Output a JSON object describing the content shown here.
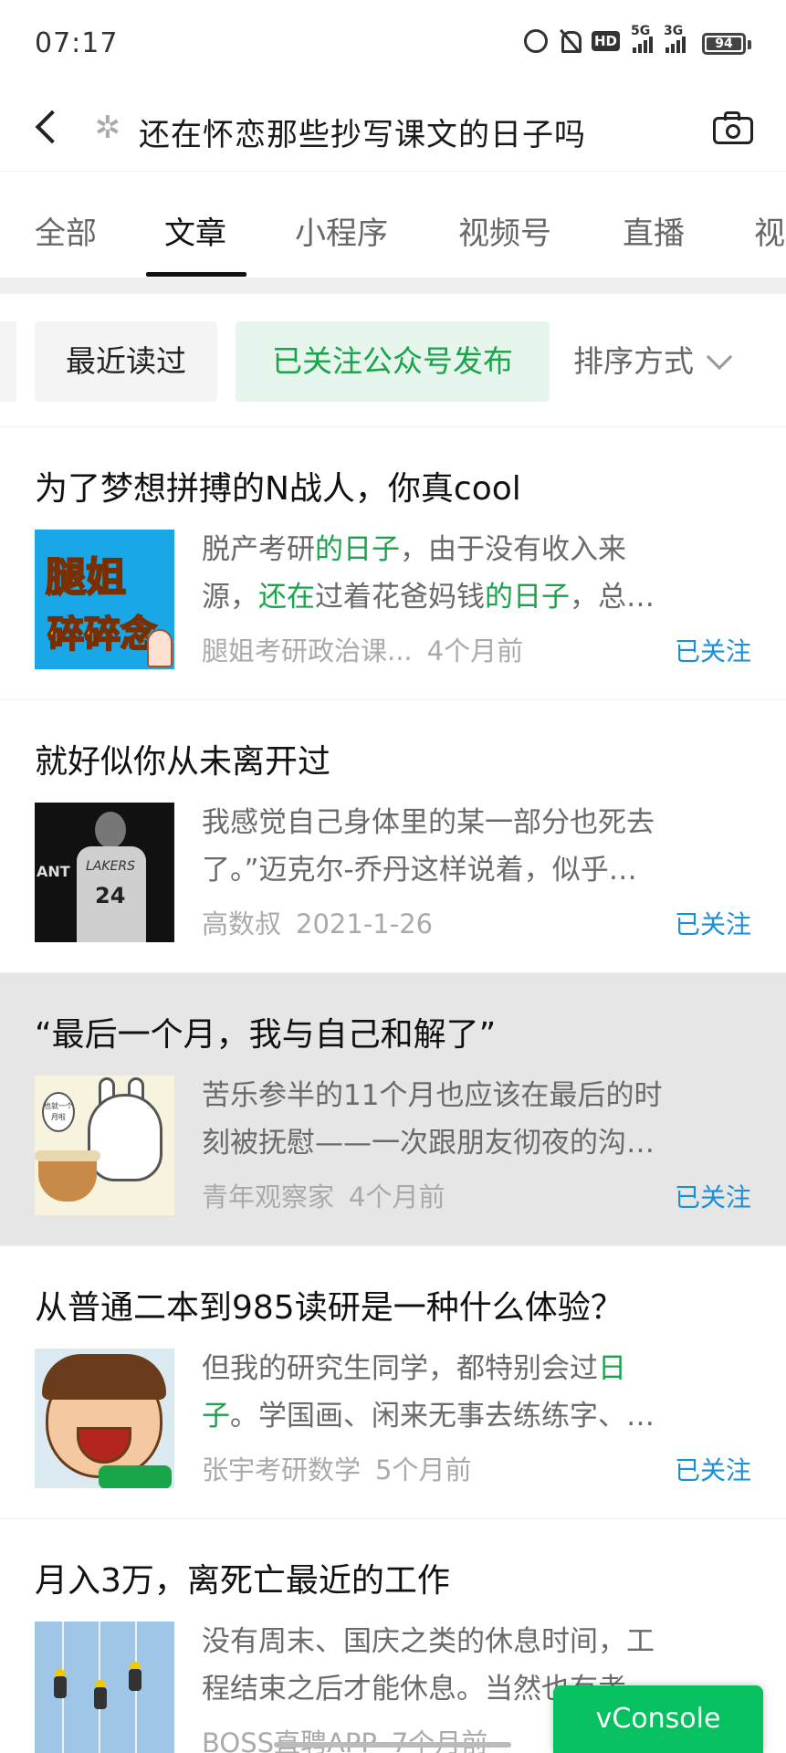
{
  "status_bar": {
    "time": "07:17",
    "hd_label": "HD",
    "net1_label": "5G",
    "net2_label": "3G",
    "battery_level": "94",
    "battery_fraction": 0.94,
    "icons": [
      "alarm-icon",
      "mute-icon",
      "hd-icon",
      "signal-5g-icon",
      "signal-3g-icon",
      "battery-icon"
    ]
  },
  "header": {
    "query": "还在怀恋那些抄写课文的日子吗",
    "loading_glyph": "✲"
  },
  "tabs": [
    {
      "label": "全部",
      "active": false
    },
    {
      "label": "文章",
      "active": true
    },
    {
      "label": "小程序",
      "active": false
    },
    {
      "label": "视频号",
      "active": false
    },
    {
      "label": "直播",
      "active": false
    },
    {
      "label": "视",
      "active": false
    }
  ],
  "filters": {
    "recent_label": "最近读过",
    "followed_label": "已关注公众号发布",
    "sort_label": "排序方式"
  },
  "colors": {
    "highlight_green": "#1aa34a",
    "followed_blue": "#1a8fd6",
    "vconsole_green": "#07c160"
  },
  "articles": [
    {
      "title": "为了梦想拼搏的N战人，你真cool",
      "thumb_text_1": "腿姐",
      "thumb_text_2": "碎碎念",
      "snippet_1_a": "脱产考研",
      "snippet_1_b": "的日子",
      "snippet_1_c": "，由于没有收入来",
      "snippet_2_a": "源，",
      "snippet_2_b": "还在",
      "snippet_2_c": "过着花爸妈钱",
      "snippet_2_d": "的日子",
      "snippet_2_e": "，总…",
      "source": "腿姐考研政治课...",
      "date": "4个月前",
      "badge": "已关注"
    },
    {
      "title": "就好似你从未离开过",
      "thumb_text_ant": "ANT",
      "thumb_text_brand": "LAKERS",
      "thumb_text_num": "24",
      "snippet_1": "我感觉自己身体里的某一部分也死去",
      "snippet_2": "了。”迈克尔-乔丹这样说着，似乎…",
      "source": "高数叔",
      "date": "2021-1-26",
      "badge": "已关注"
    },
    {
      "title": "“最后一个月，我与自己和解了”",
      "thumb_text_bubble": "也就一个月啦",
      "snippet_1": "苦乐参半的11个月也应该在最后的时",
      "snippet_2": "刻被抚慰——一次跟朋友彻夜的沟…",
      "source": "青年观察家",
      "date": "4个月前",
      "badge": "已关注"
    },
    {
      "title": "从普通二本到985读研是一种什么体验？",
      "snippet_1_a": "但我的研究生同学，都特别会过",
      "snippet_1_b": "日",
      "snippet_2_a": "子",
      "snippet_2_b": "。学国画、闲来无事去练练字、…",
      "source": "张宇考研数学",
      "date": "5个月前",
      "badge": "已关注"
    },
    {
      "title": "月入3万，离死亡最近的工作",
      "snippet_1": "没有周末、国庆之类的休息时间，工",
      "snippet_2": "程结束之后才能休息。当然也有考…",
      "source": "BOSS直聘APP",
      "date": "7个月前"
    }
  ],
  "vconsole_label": "vConsole"
}
